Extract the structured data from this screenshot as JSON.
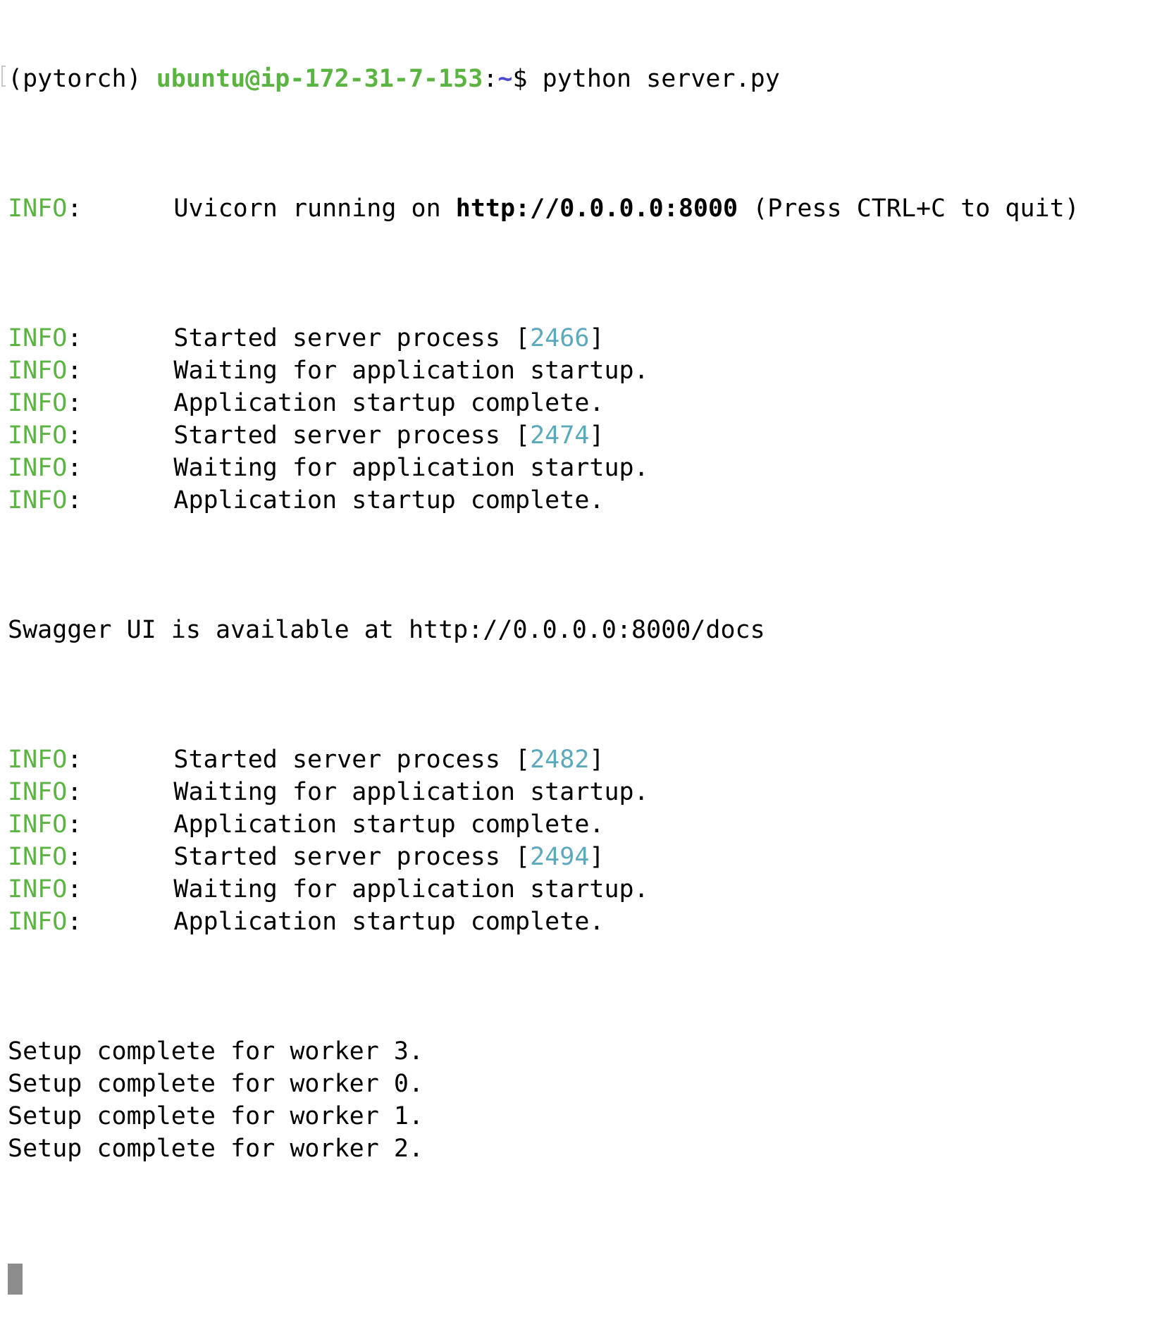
{
  "colors": {
    "background": "#ffffff",
    "text": "#000000",
    "prompt_user": "#5ab540",
    "prompt_path": "#4a4ad6",
    "info_level": "#5ab540",
    "pid": "#5aa9bd",
    "cursor": "#8c8c8c"
  },
  "prompt": {
    "env": "(pytorch) ",
    "user_host": "ubuntu@ip-172-31-7-153",
    "colon": ":",
    "path": "~",
    "symbol": "$ ",
    "command": "python server.py"
  },
  "uvicorn": {
    "level": "INFO",
    "colon": ":",
    "pre": "Uvicorn running on ",
    "url": "http://0.0.0.0:8000",
    "post": " (Press CTRL+C to quit)"
  },
  "lines": [
    {
      "level": "INFO",
      "colon": ":",
      "pre": "Started server process [",
      "pid": "2466",
      "post": "]"
    },
    {
      "level": "INFO",
      "colon": ":",
      "pre": "Waiting for application startup.",
      "pid": "",
      "post": ""
    },
    {
      "level": "INFO",
      "colon": ":",
      "pre": "Application startup complete.",
      "pid": "",
      "post": ""
    },
    {
      "level": "INFO",
      "colon": ":",
      "pre": "Started server process [",
      "pid": "2474",
      "post": "]"
    },
    {
      "level": "INFO",
      "colon": ":",
      "pre": "Waiting for application startup.",
      "pid": "",
      "post": ""
    },
    {
      "level": "INFO",
      "colon": ":",
      "pre": "Application startup complete.",
      "pid": "",
      "post": ""
    }
  ],
  "swagger_line": "Swagger UI is available at http://0.0.0.0:8000/docs",
  "lines2": [
    {
      "level": "INFO",
      "colon": ":",
      "pre": "Started server process [",
      "pid": "2482",
      "post": "]"
    },
    {
      "level": "INFO",
      "colon": ":",
      "pre": "Waiting for application startup.",
      "pid": "",
      "post": ""
    },
    {
      "level": "INFO",
      "colon": ":",
      "pre": "Application startup complete.",
      "pid": "",
      "post": ""
    },
    {
      "level": "INFO",
      "colon": ":",
      "pre": "Started server process [",
      "pid": "2494",
      "post": "]"
    },
    {
      "level": "INFO",
      "colon": ":",
      "pre": "Waiting for application startup.",
      "pid": "",
      "post": ""
    },
    {
      "level": "INFO",
      "colon": ":",
      "pre": "Application startup complete.",
      "pid": "",
      "post": ""
    }
  ],
  "setup_lines": [
    "Setup complete for worker 3.",
    "Setup complete for worker 0.",
    "Setup complete for worker 1.",
    "Setup complete for worker 2."
  ]
}
